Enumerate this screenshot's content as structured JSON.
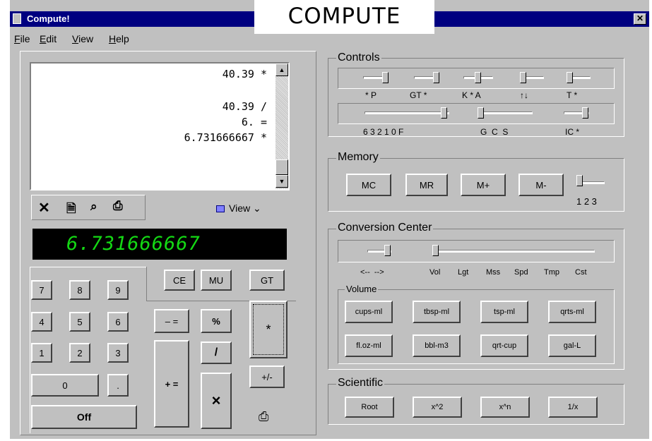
{
  "heading": "COMPUTE",
  "window": {
    "title": "Compute!",
    "close": "✕"
  },
  "menu": [
    {
      "label": "File",
      "accel": "F",
      "rest": "ile"
    },
    {
      "label": "Edit",
      "accel": "E",
      "rest": "dit"
    },
    {
      "label": "View",
      "accel": "V",
      "rest": "iew"
    },
    {
      "label": "Help",
      "accel": "H",
      "rest": "elp"
    }
  ],
  "tape": {
    "lines": [
      "40.39 *",
      "",
      "40.39 /",
      "6. =",
      "6.731666667 *"
    ]
  },
  "toolbar": {
    "view_label": "View"
  },
  "display": {
    "value": "6.731666667"
  },
  "keypad": {
    "digits": [
      "7",
      "8",
      "9",
      "4",
      "5",
      "6",
      "1",
      "2",
      "3"
    ],
    "zero": "0",
    "decimal": ".",
    "off": "Off",
    "ce": "CE",
    "mu": "MU",
    "gt": "GT",
    "minus_equals": "– =",
    "plus_equals": "+ =",
    "percent": "%",
    "divide": "/",
    "multiply_x": "×",
    "multiply_star": "*",
    "plus_minus": "+/-"
  },
  "controls": {
    "title": "Controls",
    "row1_labels": [
      "* P",
      "GT *",
      "K * A",
      "↑↓",
      "T *"
    ],
    "row2_labels": {
      "decimal": "6 3 2 1 0 F",
      "rounding": "G  C  S",
      "ic": "IC *"
    }
  },
  "memory": {
    "title": "Memory",
    "buttons": [
      "MC",
      "MR",
      "M+",
      "M-"
    ],
    "slider_labels": "1 2 3"
  },
  "conversion": {
    "title": "Conversion Center",
    "direction_label": "<--  -->",
    "categories": [
      "Vol",
      "Lgt",
      "Mss",
      "Spd",
      "Tmp",
      "Cst"
    ],
    "volume": {
      "title": "Volume",
      "buttons": [
        "cups-ml",
        "tbsp-ml",
        "tsp-ml",
        "qrts-ml",
        "fl.oz-ml",
        "bbl-m3",
        "qrt-cup",
        "gal-L"
      ]
    }
  },
  "scientific": {
    "title": "Scientific",
    "buttons": [
      "Root",
      "x^2",
      "x^n",
      "1/x"
    ]
  }
}
